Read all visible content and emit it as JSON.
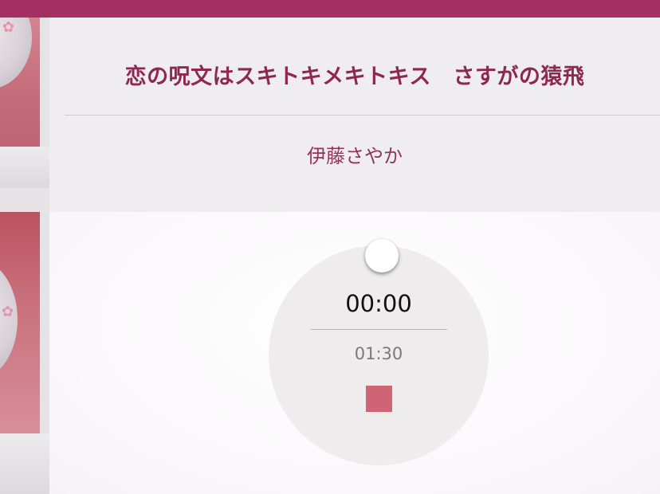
{
  "song": {
    "title": "恋の呪文はスキトキメキトキス　さすがの猿飛",
    "artist": "伊藤さやか"
  },
  "player": {
    "current_time": "00:00",
    "total_time": "01:30",
    "progress": 0.0
  },
  "colors": {
    "accent": "#a52f63",
    "title": "#8e2853",
    "stop_button": "#cf6474"
  },
  "icons": {
    "stop": "stop-icon",
    "flower": "flower-icon"
  }
}
